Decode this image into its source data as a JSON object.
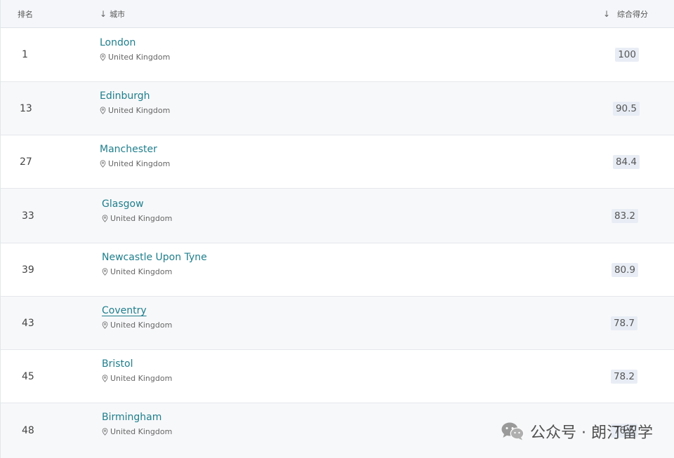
{
  "header": {
    "rank_label": "排名",
    "city_label": "城市",
    "score_label": "综合得分"
  },
  "rows": [
    {
      "rank": "1",
      "city": "London",
      "country": "United Kingdom",
      "score": "100"
    },
    {
      "rank": "13",
      "city": "Edinburgh",
      "country": "United Kingdom",
      "score": "90.5"
    },
    {
      "rank": "27",
      "city": "Manchester",
      "country": "United Kingdom",
      "score": "84.4"
    },
    {
      "rank": "33",
      "city": "Glasgow",
      "country": "United Kingdom",
      "score": "83.2"
    },
    {
      "rank": "39",
      "city": "Newcastle Upon Tyne",
      "country": "United Kingdom",
      "score": "80.9"
    },
    {
      "rank": "43",
      "city": "Coventry",
      "country": "United Kingdom",
      "score": "78.7"
    },
    {
      "rank": "45",
      "city": "Bristol",
      "country": "United Kingdom",
      "score": "78.2"
    },
    {
      "rank": "48",
      "city": "Birmingham",
      "country": "United Kingdom",
      "score": "76.5"
    }
  ],
  "watermark": {
    "text": "公众号 · 朗汀留学",
    "icon": "wechat-icon"
  },
  "colors": {
    "link": "#1f7e8c",
    "score_bg": "#e8edf5",
    "header_bg": "#f4f6f9"
  }
}
